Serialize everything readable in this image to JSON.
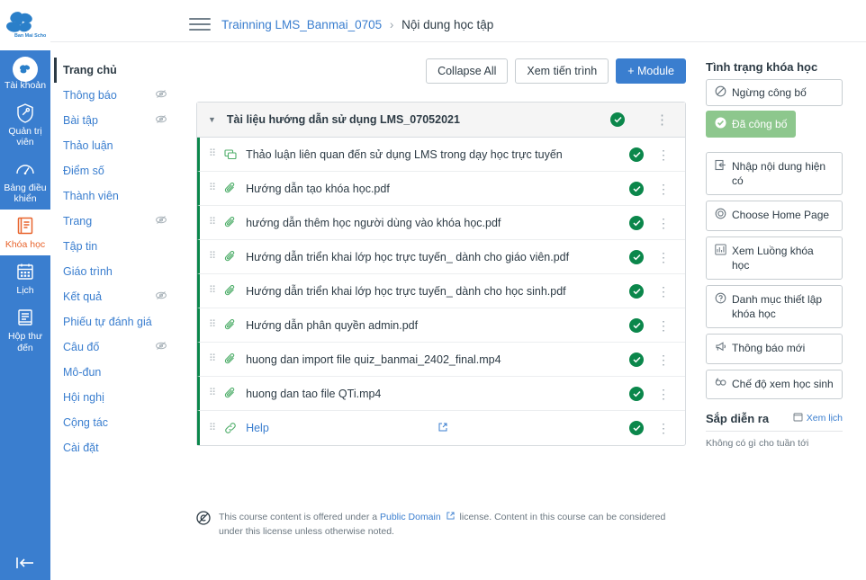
{
  "brand": {
    "name": "Ban Mai School",
    "logo_icon": "flower-logo"
  },
  "global_nav": {
    "items": [
      {
        "label": "Tài khoản",
        "icon": "account-avatar-icon",
        "active": false
      },
      {
        "label": "Quản trị viên",
        "icon": "shield-icon",
        "active": false
      },
      {
        "label": "Bảng điều khiển",
        "icon": "dashboard-icon",
        "active": false
      },
      {
        "label": "Khóa học",
        "icon": "book-icon",
        "active": true
      },
      {
        "label": "Lịch",
        "icon": "calendar-icon",
        "active": false
      },
      {
        "label": "Hộp thư đến",
        "icon": "inbox-icon",
        "active": false
      }
    ],
    "collapse_icon": "collapse-left-icon"
  },
  "header": {
    "menu_icon": "hamburger-icon",
    "breadcrumb": {
      "course": "Trainning LMS_Banmai_0705",
      "separator": "›",
      "current": "Nội dung học tập"
    }
  },
  "course_nav": {
    "items": [
      {
        "label": "Trang chủ",
        "active": true,
        "hidden_icon": false
      },
      {
        "label": "Thông báo",
        "active": false,
        "hidden_icon": true
      },
      {
        "label": "Bài tập",
        "active": false,
        "hidden_icon": true
      },
      {
        "label": "Thảo luận",
        "active": false,
        "hidden_icon": false
      },
      {
        "label": "Điểm số",
        "active": false,
        "hidden_icon": false
      },
      {
        "label": "Thành viên",
        "active": false,
        "hidden_icon": false
      },
      {
        "label": "Trang",
        "active": false,
        "hidden_icon": true
      },
      {
        "label": "Tập tin",
        "active": false,
        "hidden_icon": false
      },
      {
        "label": "Giáo trình",
        "active": false,
        "hidden_icon": false
      },
      {
        "label": "Kết quả",
        "active": false,
        "hidden_icon": true
      },
      {
        "label": "Phiếu tự đánh giá",
        "active": false,
        "hidden_icon": false
      },
      {
        "label": "Câu đố",
        "active": false,
        "hidden_icon": true
      },
      {
        "label": "Mô-đun",
        "active": false,
        "hidden_icon": false
      },
      {
        "label": "Hội nghị",
        "active": false,
        "hidden_icon": false
      },
      {
        "label": "Cộng tác",
        "active": false,
        "hidden_icon": false
      },
      {
        "label": "Cài đặt",
        "active": false,
        "hidden_icon": false
      }
    ],
    "hidden_icon_name": "eye-slash-icon"
  },
  "toolbar": {
    "collapse_all": "Collapse All",
    "view_progress": "Xem tiến trình",
    "add_module": "+ Module"
  },
  "module": {
    "title": "Tài liệu hướng dẫn sử dụng LMS_07052021",
    "caret_icon": "caret-down-icon",
    "published_icon": "published-check-icon",
    "add_icon": "plus-icon",
    "menu_icon": "kebab-menu-icon",
    "items": [
      {
        "title": "Thảo luận liên quan đến sử dụng LMS trong dạy học trực tuyến",
        "icon": "discussion-icon",
        "is_link": false,
        "published": true
      },
      {
        "title": "Hướng dẫn tạo khóa học.pdf",
        "icon": "paperclip-icon",
        "is_link": false,
        "published": true
      },
      {
        "title": "hướng dẫn thêm học người dùng vào khóa học.pdf",
        "icon": "paperclip-icon",
        "is_link": false,
        "published": true
      },
      {
        "title": "Hướng dẫn triển khai lớp học trực tuyến_ dành cho giáo viên.pdf",
        "icon": "paperclip-icon",
        "is_link": false,
        "published": true
      },
      {
        "title": "Hướng dẫn triển khai lớp học trực tuyến_ dành cho học sinh.pdf",
        "icon": "paperclip-icon",
        "is_link": false,
        "published": true
      },
      {
        "title": "Hướng dẫn phân quyền admin.pdf",
        "icon": "paperclip-icon",
        "is_link": false,
        "published": true
      },
      {
        "title": "huong dan import file quiz_banmai_2402_final.mp4",
        "icon": "paperclip-icon",
        "is_link": false,
        "published": true
      },
      {
        "title": "huong dan tao file QTi.mp4",
        "icon": "paperclip-icon",
        "is_link": false,
        "published": true
      },
      {
        "title": "Help",
        "icon": "link-icon",
        "is_link": true,
        "published": true,
        "external_icon": "external-link-icon"
      }
    ],
    "drag_handle_icon": "drag-handle-icon"
  },
  "license": {
    "icon": "public-domain-icon",
    "text_before": "This course content is offered under a ",
    "link": "Public Domain",
    "link_external_icon": "external-link-icon",
    "text_after": " license. Content in this course can be considered under this license unless otherwise noted."
  },
  "right_sidebar": {
    "status_heading": "Tình trạng khóa học",
    "unpublish_label": "Ngừng công bố",
    "unpublish_icon": "circle-slash-icon",
    "published_label": "Đã công bố",
    "published_icon": "check-circle-icon",
    "actions": [
      {
        "label": "Nhập nội dung hiện có",
        "icon": "import-icon"
      },
      {
        "label": "Choose Home Page",
        "icon": "target-icon"
      },
      {
        "label": "Xem Luồng khóa học",
        "icon": "stream-chart-icon"
      },
      {
        "label": "Danh mục thiết lập khóa học",
        "icon": "question-circle-icon"
      },
      {
        "label": "Thông báo mới",
        "icon": "announcement-icon"
      },
      {
        "label": "Chế độ xem học sinh",
        "icon": "student-view-icon"
      }
    ],
    "upcoming_heading": "Sắp diễn ra",
    "calendar_link": "Xem lịch",
    "calendar_icon": "calendar-icon",
    "upcoming_empty": "Không có gì cho tuần tới"
  },
  "colors": {
    "brand_blue": "#3a7ecf",
    "active_orange": "#e8642d",
    "published_green": "#0b874b",
    "published_badge": "#8dc78d",
    "link_blue": "#3a7ecf"
  }
}
